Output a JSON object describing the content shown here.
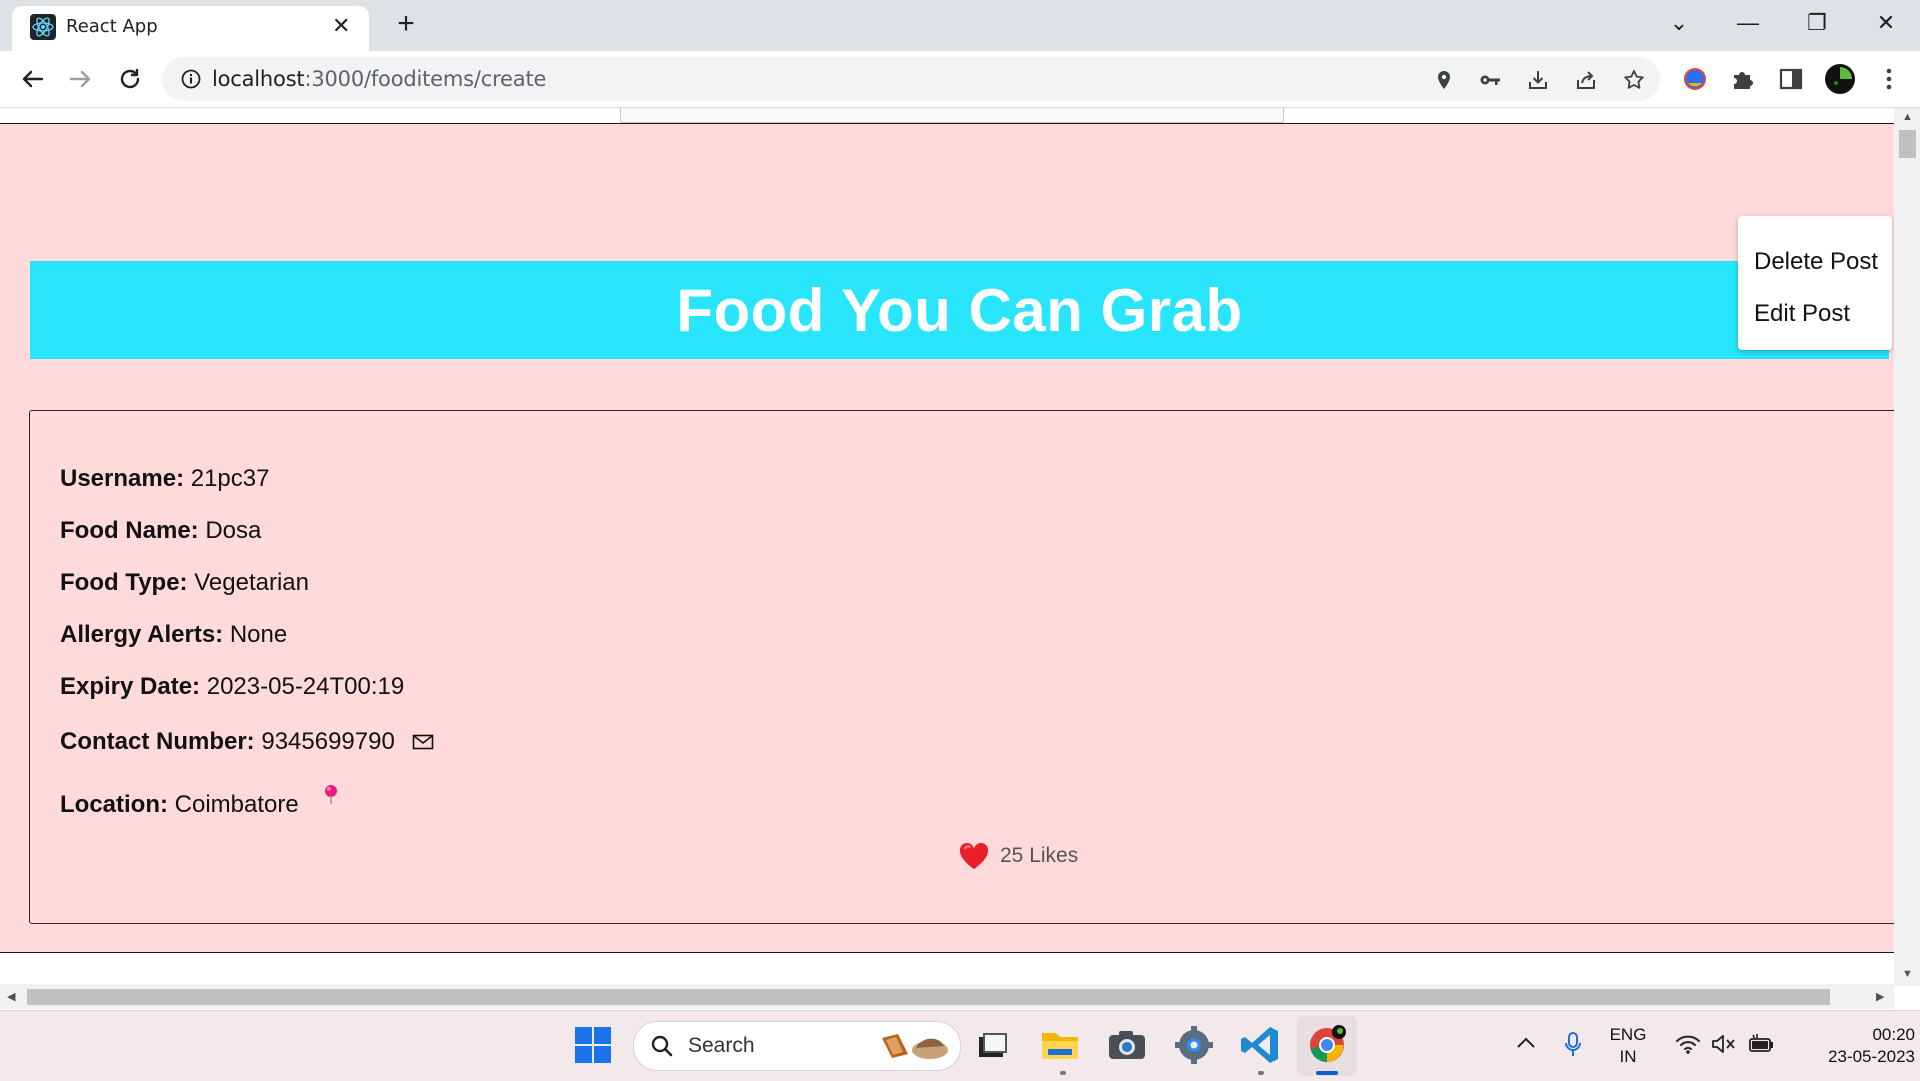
{
  "browser": {
    "tab_title": "React App",
    "tab_close": "✕",
    "new_tab": "+",
    "url_host": "localhost",
    "url_path": ":3000/fooditems/create",
    "window_controls": {
      "minimize": "—",
      "restore": "❐",
      "close": "✕",
      "tab_search": "⌄"
    }
  },
  "page": {
    "banner_title": "Food You Can Grab",
    "menu": {
      "delete_label": "Delete Post",
      "edit_label": "Edit Post"
    },
    "post": {
      "username_label": "Username:",
      "username_value": "21pc37",
      "food_name_label": "Food Name:",
      "food_name_value": "Dosa",
      "food_type_label": "Food Type:",
      "food_type_value": "Vegetarian",
      "allergy_label": "Allergy Alerts:",
      "allergy_value": "None",
      "expiry_label": "Expiry Date:",
      "expiry_value": "2023-05-24T00:19",
      "contact_label": "Contact Number:",
      "contact_value": "9345699790",
      "location_label": "Location:",
      "location_value": "Coimbatore",
      "likes_text": "25 Likes"
    },
    "colors": {
      "page_bg": "#ffdadb",
      "banner_bg": "#29e5fb",
      "heart": "#e8202a",
      "pin": "#f0197d"
    }
  },
  "taskbar": {
    "search_label": "Search",
    "lang_line1": "ENG",
    "lang_line2": "IN",
    "time": "00:20",
    "date": "23-05-2023",
    "apps": [
      "windows-start-icon",
      "file-manager-icon",
      "file-explorer-icon",
      "camera-icon",
      "settings-icon",
      "vscode-icon",
      "chrome-icon"
    ]
  }
}
